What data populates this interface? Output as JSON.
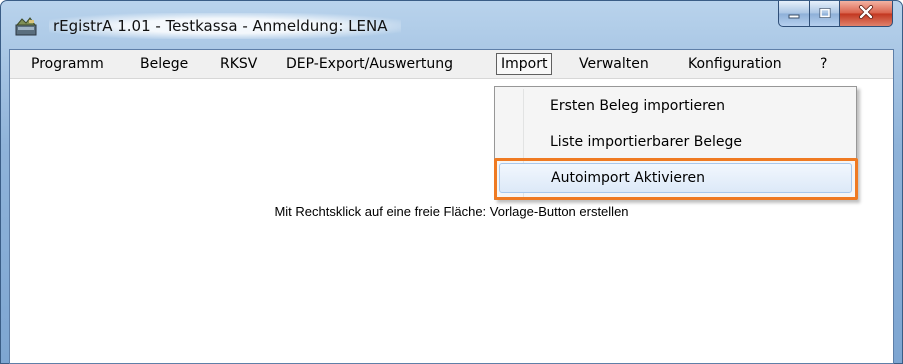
{
  "window": {
    "title": "rEgistrA 1.01 - Testkassa - Anmeldung: LENA",
    "icon": "cash-register-icon",
    "controls": [
      "minimize-icon",
      "maximize-icon",
      "close-icon"
    ]
  },
  "menubar": {
    "items": [
      "Programm",
      "Belege",
      "RKSV",
      "DEP-Export/Auswertung",
      "Import",
      "Verwalten",
      "Konfiguration",
      "?"
    ],
    "open_item": "Import"
  },
  "import_menu": {
    "items": [
      "Ersten Beleg importieren",
      "Liste importierbarer Belege",
      "Autoimport Aktivieren"
    ],
    "hovered_item": "Autoimport Aktivieren"
  },
  "main": {
    "hint": "Mit Rechtsklick auf eine freie Fläche: Vorlage-Button erstellen"
  },
  "colors": {
    "highlight_outline": "#ef7a22",
    "menu_hover": "#dce9f8",
    "close_button": "#c2361f",
    "frame": "#8fb3d9"
  }
}
